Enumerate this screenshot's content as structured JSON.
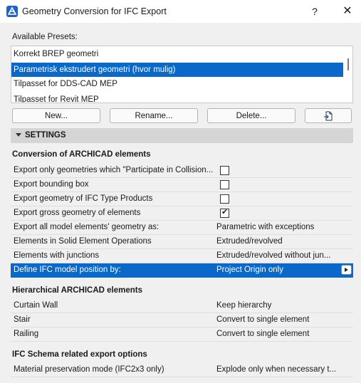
{
  "window": {
    "title": "Geometry Conversion for IFC Export",
    "help": "?",
    "close": "✕",
    "accent": "#0a69c8"
  },
  "presets": {
    "label": "Available Presets:",
    "items": [
      "Korrekt BREP geometri",
      "Parametrisk ekstrudert geometri (hvor mulig)",
      "Tilpasset for DDS-CAD MEP",
      "Tilpasset for Revit MEP"
    ],
    "selected_index": 1
  },
  "buttons": {
    "new": "New...",
    "rename": "Rename...",
    "delete": "Delete..."
  },
  "settings": {
    "header": "SETTINGS",
    "conversion": {
      "title": "Conversion of ARCHICAD elements",
      "rows": [
        {
          "label": "Export only geometries which \"Participate in Collision...",
          "checked": false
        },
        {
          "label": "Export bounding box",
          "checked": false
        },
        {
          "label": "Export geometry of IFC Type Products",
          "checked": false
        },
        {
          "label": "Export gross geometry of elements",
          "checked": true
        },
        {
          "label": "Export all model elements' geometry as:",
          "value": "Parametric with exceptions"
        },
        {
          "label": "Elements in Solid Element Operations",
          "value": "Extruded/revolved"
        },
        {
          "label": "Elements with junctions",
          "value": "Extruded/revolved without jun..."
        },
        {
          "label": "Define IFC model position by:",
          "value": "Project Origin only",
          "selected": true
        }
      ]
    },
    "hierarchical": {
      "title": "Hierarchical ARCHICAD elements",
      "rows": [
        {
          "label": "Curtain Wall",
          "value": "Keep hierarchy"
        },
        {
          "label": "Stair",
          "value": "Convert to single element"
        },
        {
          "label": "Railing",
          "value": "Convert to single element"
        }
      ]
    },
    "schema": {
      "title": "IFC Schema related export options",
      "rows": [
        {
          "label": "Material preservation mode (IFC2x3 only)",
          "value": "Explode only when necessary t..."
        }
      ]
    }
  }
}
